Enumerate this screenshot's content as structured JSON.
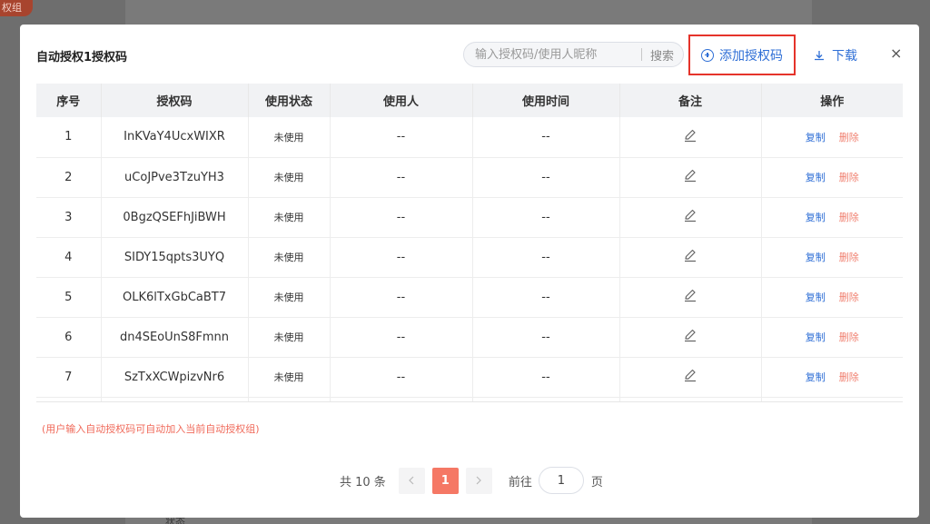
{
  "background": {
    "badge": "权组",
    "bottom_text": "状态"
  },
  "modal": {
    "title": "自动授权1授权码",
    "search": {
      "placeholder": "输入授权码/使用人昵称",
      "button": "搜索"
    },
    "add_button": "添加授权码",
    "download_button": "下载",
    "close_symbol": "×"
  },
  "table": {
    "columns": [
      "序号",
      "授权码",
      "使用状态",
      "使用人",
      "使用时间",
      "备注",
      "操作"
    ],
    "rows": [
      {
        "index": "1",
        "code": "InKVaY4UcxWIXR",
        "status": "未使用",
        "user": "--",
        "time": "--"
      },
      {
        "index": "2",
        "code": "uCoJPve3TzuYH3",
        "status": "未使用",
        "user": "--",
        "time": "--"
      },
      {
        "index": "3",
        "code": "0BgzQSEFhJiBWH",
        "status": "未使用",
        "user": "--",
        "time": "--"
      },
      {
        "index": "4",
        "code": "SIDY15qpts3UYQ",
        "status": "未使用",
        "user": "--",
        "time": "--"
      },
      {
        "index": "5",
        "code": "OLK6lTxGbCaBT7",
        "status": "未使用",
        "user": "--",
        "time": "--"
      },
      {
        "index": "6",
        "code": "dn4SEoUnS8Fmnn",
        "status": "未使用",
        "user": "--",
        "time": "--"
      },
      {
        "index": "7",
        "code": "SzTxXCWpizvNr6",
        "status": "未使用",
        "user": "--",
        "time": "--"
      }
    ],
    "actions": {
      "copy": "复制",
      "delete": "删除"
    }
  },
  "hint": "(用户输入自动授权码可自动加入当前自动授权组)",
  "pagination": {
    "total": "共 10 条",
    "current_page": "1",
    "goto_label": "前往",
    "goto_value": "1",
    "page_suffix": "页"
  },
  "colors": {
    "accent": "#2f6fd6",
    "danger": "#f08070",
    "highlight_border": "#e5332a",
    "active_page": "#f57865"
  }
}
